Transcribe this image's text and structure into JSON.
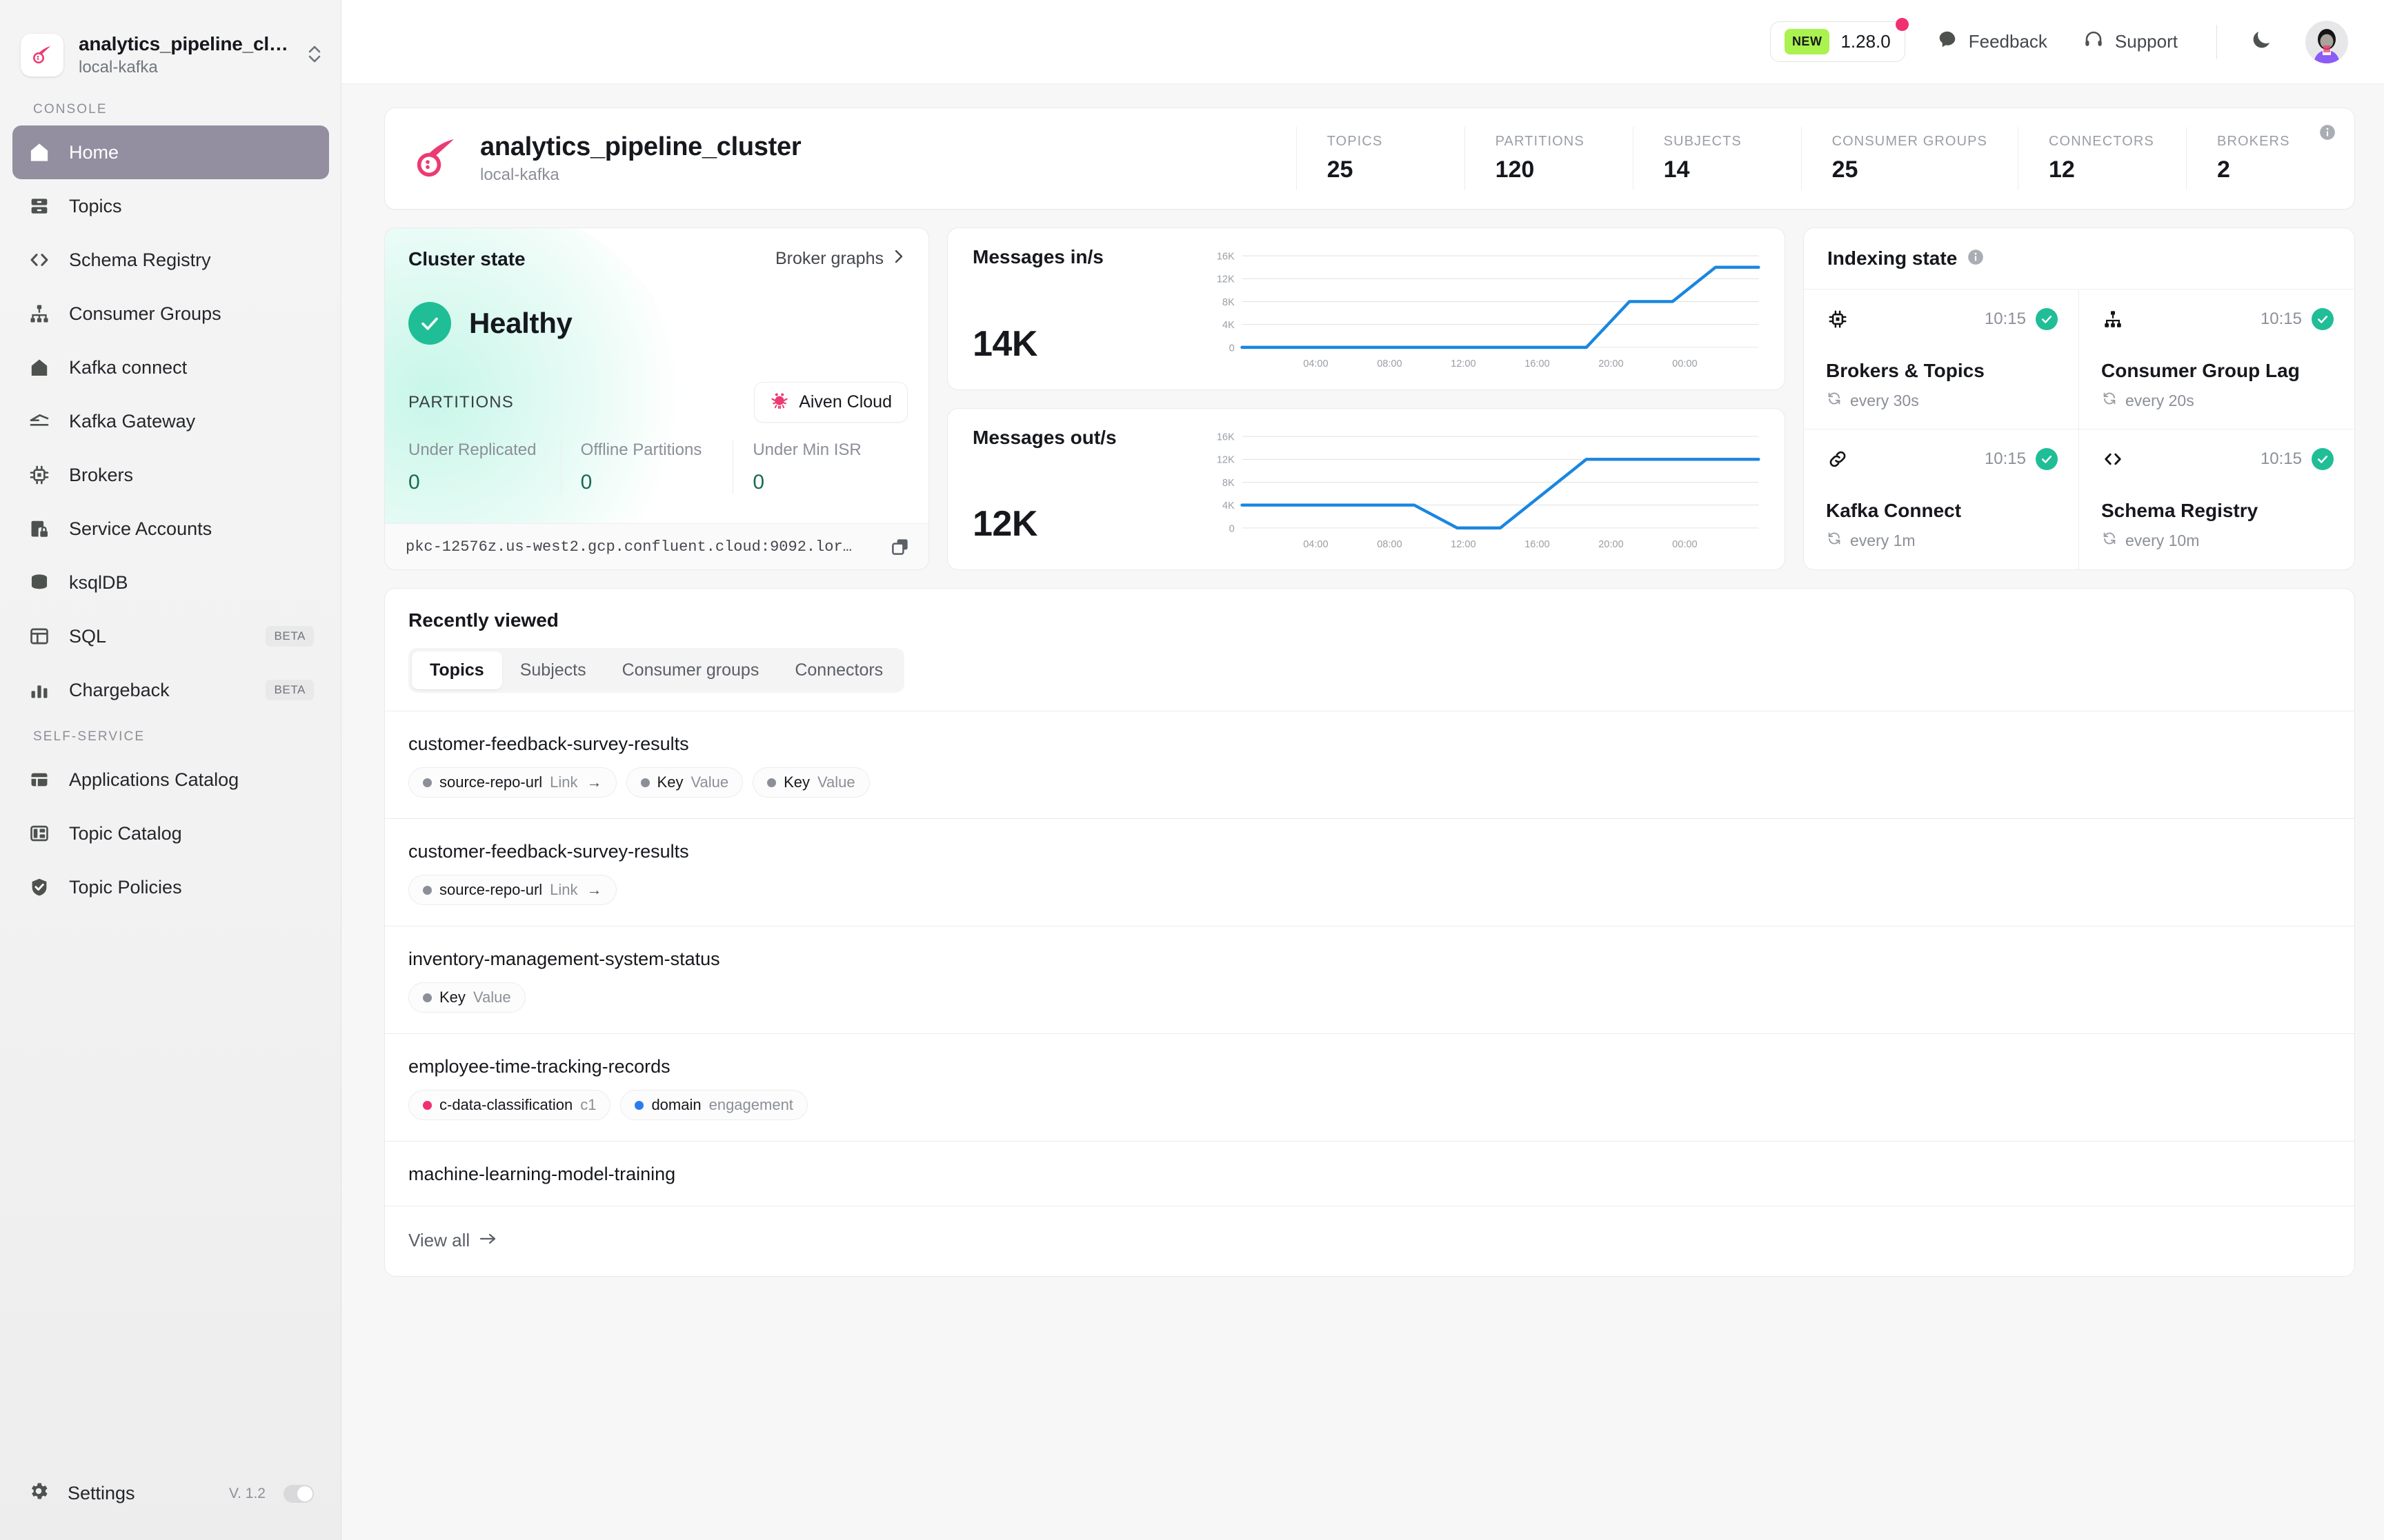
{
  "sidebar": {
    "cluster": {
      "name": "analytics_pipeline_cl…",
      "environment": "local-kafka"
    },
    "sections": [
      {
        "label": "CONSOLE",
        "items": [
          {
            "label": "Home",
            "icon": "home-icon",
            "active": true,
            "badge": ""
          },
          {
            "label": "Topics",
            "icon": "topics-icon",
            "active": false,
            "badge": ""
          },
          {
            "label": "Schema Registry",
            "icon": "code-brackets-icon",
            "active": false,
            "badge": ""
          },
          {
            "label": "Consumer Groups",
            "icon": "hierarchy-icon",
            "active": false,
            "badge": ""
          },
          {
            "label": "Kafka connect",
            "icon": "connect-icon",
            "active": false,
            "badge": ""
          },
          {
            "label": "Kafka Gateway",
            "icon": "gateway-icon",
            "active": false,
            "badge": ""
          },
          {
            "label": "Brokers",
            "icon": "chip-icon",
            "active": false,
            "badge": ""
          },
          {
            "label": "Service Accounts",
            "icon": "lock-card-icon",
            "active": false,
            "badge": ""
          },
          {
            "label": "ksqlDB",
            "icon": "database-icon",
            "active": false,
            "badge": ""
          },
          {
            "label": "SQL",
            "icon": "table-icon",
            "active": false,
            "badge": "BETA"
          },
          {
            "label": "Chargeback",
            "icon": "bar-chart-icon",
            "active": false,
            "badge": "BETA"
          }
        ]
      },
      {
        "label": "SELF-SERVICE",
        "items": [
          {
            "label": "Applications Catalog",
            "icon": "window-icon",
            "active": false,
            "badge": ""
          },
          {
            "label": "Topic Catalog",
            "icon": "layout-icon",
            "active": false,
            "badge": ""
          },
          {
            "label": "Topic Policies",
            "icon": "shield-check-icon",
            "active": false,
            "badge": ""
          }
        ]
      }
    ],
    "footer": {
      "settings_label": "Settings",
      "version": "V. 1.2"
    }
  },
  "topbar": {
    "new_chip": "NEW",
    "version": "1.28.0",
    "feedback_label": "Feedback",
    "support_label": "Support"
  },
  "cluster_header": {
    "name": "analytics_pipeline_cluster",
    "environment": "local-kafka",
    "stats": [
      {
        "label": "TOPICS",
        "value": "25"
      },
      {
        "label": "PARTITIONS",
        "value": "120"
      },
      {
        "label": "SUBJECTS",
        "value": "14"
      },
      {
        "label": "CONSUMER GROUPS",
        "value": "25"
      },
      {
        "label": "CONNECTORS",
        "value": "12"
      },
      {
        "label": "BROKERS",
        "value": "2"
      }
    ]
  },
  "cluster_state": {
    "title": "Cluster state",
    "broker_graphs_label": "Broker graphs",
    "status": "Healthy",
    "status_color": "#1fbe96",
    "partitions_label": "PARTITIONS",
    "cloud_badge": "Aiven Cloud",
    "metrics": [
      {
        "label": "Under Replicated",
        "value": "0"
      },
      {
        "label": "Offline Partitions",
        "value": "0"
      },
      {
        "label": "Under Min ISR",
        "value": "0"
      }
    ],
    "bootstrap_url": "pkc-12576z.us-west2.gcp.confluent.cloud:9092.lor…"
  },
  "chart_data": [
    {
      "type": "line",
      "title": "Messages in/s",
      "current_value": "14K",
      "xlabel": "",
      "ylabel": "",
      "ylim": [
        0,
        16000
      ],
      "yticks": [
        0,
        4000,
        8000,
        12000,
        16000
      ],
      "ytick_labels": [
        "0",
        "4K",
        "8K",
        "12K",
        "16K"
      ],
      "xtick_labels": [
        "04:00",
        "08:00",
        "12:00",
        "16:00",
        "20:00",
        "00:00"
      ],
      "grid": true,
      "line_color": "#1a86e0",
      "x": [
        0,
        1,
        2,
        3,
        4,
        5,
        6,
        7,
        8,
        9,
        10,
        11,
        12
      ],
      "values": [
        0,
        0,
        0,
        0,
        0,
        0,
        0,
        0,
        0,
        8000,
        8000,
        14000,
        14000
      ]
    },
    {
      "type": "line",
      "title": "Messages out/s",
      "current_value": "12K",
      "xlabel": "",
      "ylabel": "",
      "ylim": [
        0,
        16000
      ],
      "yticks": [
        0,
        4000,
        8000,
        12000,
        16000
      ],
      "ytick_labels": [
        "0",
        "4K",
        "8K",
        "12K",
        "16K"
      ],
      "xtick_labels": [
        "04:00",
        "08:00",
        "12:00",
        "16:00",
        "20:00",
        "00:00"
      ],
      "grid": true,
      "line_color": "#1a86e0",
      "x": [
        0,
        1,
        2,
        3,
        4,
        5,
        6,
        7,
        8,
        9,
        10,
        11,
        12
      ],
      "values": [
        4000,
        4000,
        4000,
        4000,
        4000,
        0,
        0,
        6000,
        12000,
        12000,
        12000,
        12000,
        12000
      ]
    }
  ],
  "indexing_state": {
    "title": "Indexing state",
    "cells": [
      {
        "name": "Brokers & Topics",
        "time": "10:15",
        "frequency": "every 30s",
        "icon": "chip-icon",
        "status": "ok"
      },
      {
        "name": "Consumer Group Lag",
        "time": "10:15",
        "frequency": "every 20s",
        "icon": "hierarchy-icon",
        "status": "ok"
      },
      {
        "name": "Kafka Connect",
        "time": "10:15",
        "frequency": "every 1m",
        "icon": "link-icon",
        "status": "ok"
      },
      {
        "name": "Schema Registry",
        "time": "10:15",
        "frequency": "every 10m",
        "icon": "code-brackets-icon",
        "status": "ok"
      }
    ]
  },
  "recently_viewed": {
    "title": "Recently viewed",
    "tabs": [
      {
        "label": "Topics",
        "active": true
      },
      {
        "label": "Subjects",
        "active": false
      },
      {
        "label": "Consumer groups",
        "active": false
      },
      {
        "label": "Connectors",
        "active": false
      }
    ],
    "rows": [
      {
        "name": "customer-feedback-survey-results",
        "tags": [
          {
            "key": "source-repo-url",
            "value": "Link",
            "arrow": "→",
            "dot_color": "#8b8f97"
          },
          {
            "key": "Key",
            "value": "Value",
            "arrow": "",
            "dot_color": "#8b8f97"
          },
          {
            "key": "Key",
            "value": "Value",
            "arrow": "",
            "dot_color": "#8b8f97"
          }
        ]
      },
      {
        "name": "customer-feedback-survey-results",
        "tags": [
          {
            "key": "source-repo-url",
            "value": "Link",
            "arrow": "→",
            "dot_color": "#8b8f97"
          }
        ]
      },
      {
        "name": "inventory-management-system-status",
        "tags": [
          {
            "key": "Key",
            "value": "Value",
            "arrow": "",
            "dot_color": "#8b8f97"
          }
        ]
      },
      {
        "name": "employee-time-tracking-records",
        "tags": [
          {
            "key": "c-data-classification",
            "value": "c1",
            "arrow": "",
            "dot_color": "#f0306f"
          },
          {
            "key": "domain",
            "value": "engagement",
            "arrow": "",
            "dot_color": "#2b7cf0"
          }
        ]
      },
      {
        "name": "machine-learning-model-training",
        "tags": []
      }
    ],
    "view_all_label": "View all"
  }
}
